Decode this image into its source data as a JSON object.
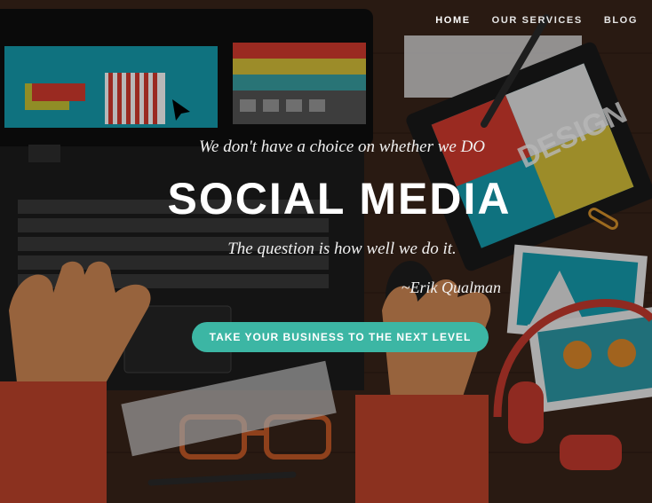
{
  "nav": {
    "items": [
      {
        "label": "HOME",
        "active": true
      },
      {
        "label": "OUR SERVICES",
        "active": false
      },
      {
        "label": "BLOG",
        "active": false
      }
    ]
  },
  "hero": {
    "quote_line1": "We don't have a choice on whether we DO",
    "title": "SOCIAL MEDIA",
    "quote_line2": "The question is how well we do it.",
    "author": "~Erik Qualman",
    "cta_label": "TAKE YOUR BUSINESS TO THE NEXT LEVEL",
    "illustration_text": "DESIGN"
  },
  "colors": {
    "accent": "#3cb6a4",
    "background": "#2a1a12"
  }
}
